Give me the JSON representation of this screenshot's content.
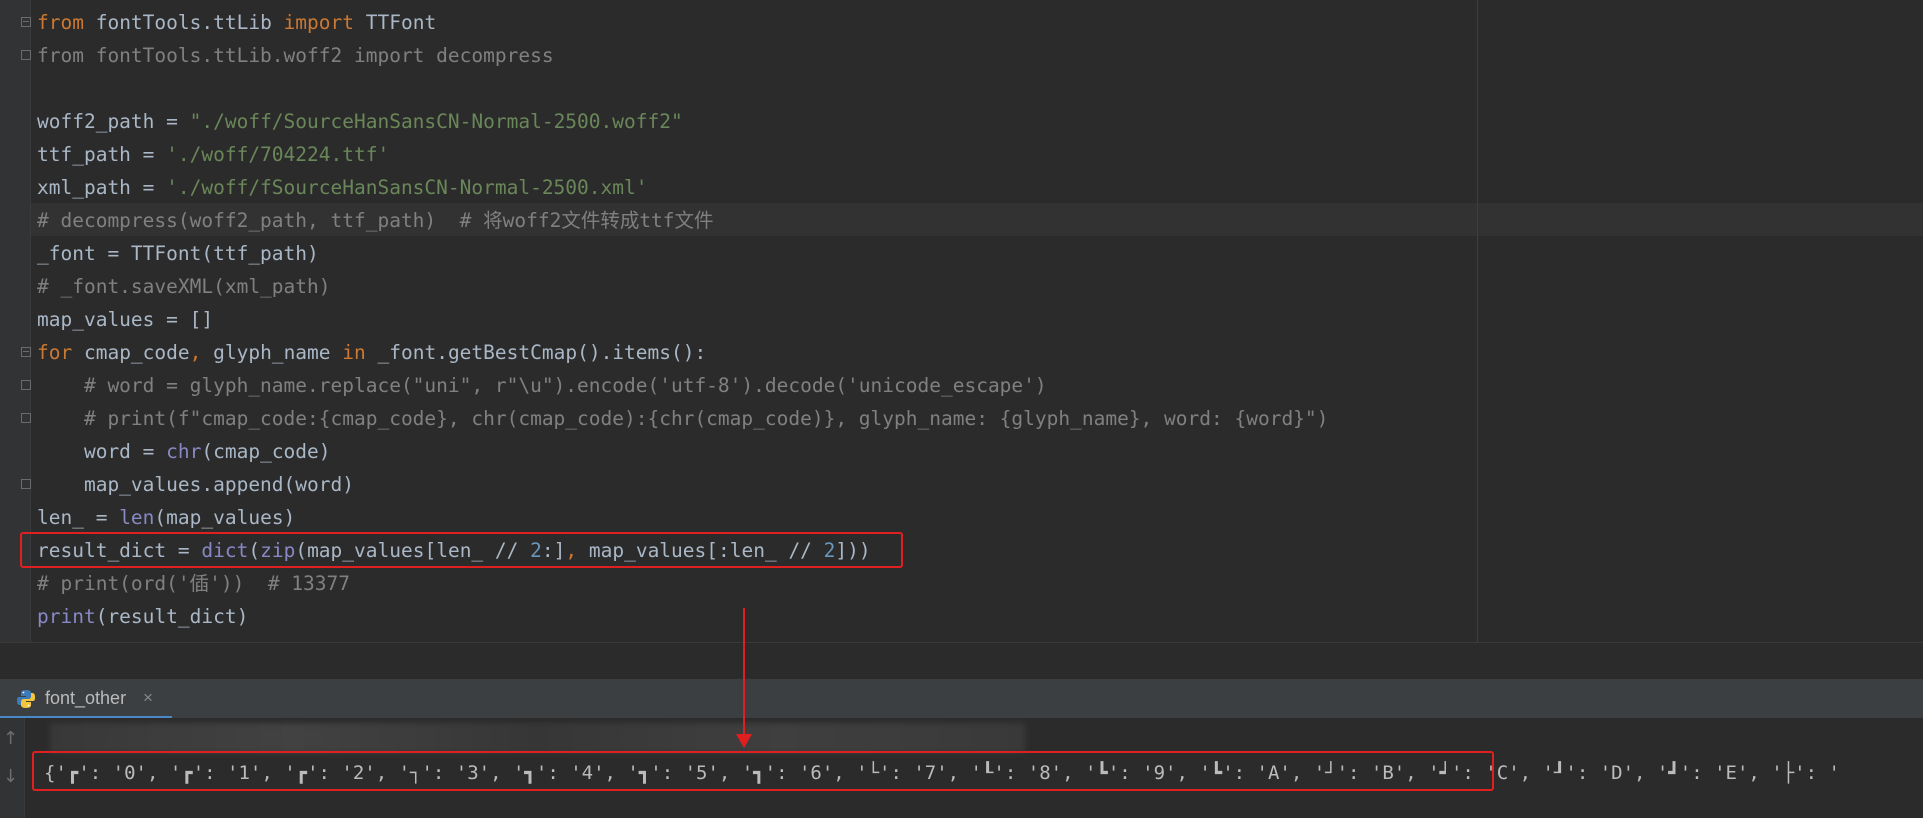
{
  "code_lines": [
    [
      {
        "t": "from",
        "c": "kw"
      },
      {
        "t": " fontTools.ttLib "
      },
      {
        "t": "import",
        "c": "kw"
      },
      {
        "t": " TTFont"
      }
    ],
    [
      {
        "t": "from fontTools.ttLib.woff2 import decompress",
        "c": "cm"
      }
    ],
    [],
    [
      {
        "t": "woff2_path = "
      },
      {
        "t": "\"./woff/SourceHanSansCN-Normal-2500.woff2\"",
        "c": "str"
      }
    ],
    [
      {
        "t": "ttf_path = "
      },
      {
        "t": "'./woff/704224.ttf'",
        "c": "str"
      }
    ],
    [
      {
        "t": "xml_path = "
      },
      {
        "t": "'./woff/fSourceHanSansCN-Normal-2500.xml'",
        "c": "str"
      }
    ],
    [
      {
        "t": "# decompress(woff2_path, ttf_path)  # 将woff2文件转成ttf文件",
        "c": "cm"
      }
    ],
    [
      {
        "t": "_font = TTFont(ttf_path)"
      }
    ],
    [
      {
        "t": "# _font.saveXML(xml_path)",
        "c": "cm"
      }
    ],
    [
      {
        "t": "map_values = []"
      }
    ],
    [
      {
        "t": "for",
        "c": "kw"
      },
      {
        "t": " cmap_code"
      },
      {
        "t": ",",
        "c": "kw"
      },
      {
        "t": " glyph_name "
      },
      {
        "t": "in",
        "c": "kw"
      },
      {
        "t": " _font.getBestCmap().items():"
      }
    ],
    [
      {
        "t": "    # word = glyph_name.replace(\"uni\", r\"\\u\").encode('utf-8').decode('unicode_escape')",
        "c": "cm"
      }
    ],
    [
      {
        "t": "    # print(f\"cmap_code:{cmap_code}, chr(cmap_code):{chr(cmap_code)}, glyph_name: {glyph_name}, word: {word}\")",
        "c": "cm"
      }
    ],
    [
      {
        "t": "    word = "
      },
      {
        "t": "chr",
        "c": "bi"
      },
      {
        "t": "(cmap_code)"
      }
    ],
    [
      {
        "t": "    map_values.append(word)"
      }
    ],
    [
      {
        "t": "len_ = "
      },
      {
        "t": "len",
        "c": "bi"
      },
      {
        "t": "(map_values)"
      }
    ],
    [
      {
        "t": "result_dict = "
      },
      {
        "t": "dict",
        "c": "bi"
      },
      {
        "t": "("
      },
      {
        "t": "zip",
        "c": "bi"
      },
      {
        "t": "(map_values[len_ // "
      },
      {
        "t": "2",
        "c": "num"
      },
      {
        "t": ":]"
      },
      {
        "t": ",",
        "c": "kw"
      },
      {
        "t": " map_values[:len_ // "
      },
      {
        "t": "2",
        "c": "num"
      },
      {
        "t": "]))"
      }
    ],
    [
      {
        "t": "# print(ord('偛'))  # 13377",
        "c": "cm"
      }
    ],
    [
      {
        "t": "print",
        "c": "bi"
      },
      {
        "t": "(result_dict)"
      }
    ]
  ],
  "run_tab": {
    "label": "font_other",
    "close": "×",
    "icon": "python-icon"
  },
  "run_arrows": {
    "up": "↑",
    "down": "↓"
  },
  "output_text": "{'┏': '0', '┏': '1', '┏': '2', '┐': '3', '┓': '4', '┓': '5', '┓': '6', '└': '7', '┖': '8', '┗': '9', '┗': 'A', '┘': 'B', '┙': 'C', '┚': 'D', '┛': 'E', '├': '",
  "colors": {
    "highlight": "#e02020",
    "background": "#2b2b2b"
  }
}
